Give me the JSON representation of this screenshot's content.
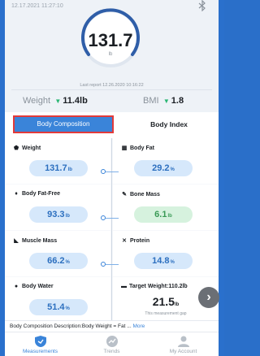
{
  "header": {
    "datetime": "12.17.2021 11:27:10",
    "weight_value": "131.7",
    "weight_unit": "lb",
    "last_report": "Last report 12.26.2020 10:16:22"
  },
  "summary": {
    "weight_label": "Weight",
    "weight_change": "11.4lb",
    "bmi_label": "BMI",
    "bmi_change": "1.8",
    "change_color": "#2ab673"
  },
  "tabs": {
    "composition": "Body Composition",
    "index": "Body Index"
  },
  "metrics": {
    "weight": {
      "label": "Weight",
      "value": "131.7",
      "unit": "lb",
      "icon": "scale-icon"
    },
    "body_fat": {
      "label": "Body Fat",
      "value": "29.2",
      "unit": "%",
      "icon": "body-fat-icon"
    },
    "body_fat_free": {
      "label": "Body Fat-Free",
      "value": "93.3",
      "unit": "lb",
      "icon": "person-icon"
    },
    "bone_mass": {
      "label": "Bone Mass",
      "value": "6.1",
      "unit": "lb",
      "icon": "bone-icon"
    },
    "muscle_mass": {
      "label": "Muscle Mass",
      "value": "66.2",
      "unit": "%",
      "icon": "muscle-icon"
    },
    "protein": {
      "label": "Protein",
      "value": "14.8",
      "unit": "%",
      "icon": "protein-icon"
    },
    "body_water": {
      "label": "Body Water",
      "value": "51.4",
      "unit": "%",
      "icon": "water-drop-icon"
    },
    "target": {
      "label": "Target Weight:110.2lb",
      "value": "21.5",
      "unit": "lb",
      "note": "This measurement gap",
      "icon": "flag-icon"
    }
  },
  "description": {
    "text": "Body Composition Description:Body Weight = Fat ...",
    "more": "More"
  },
  "nav": {
    "measurements": "Measurements",
    "trends": "Trends",
    "account": "My Account"
  }
}
